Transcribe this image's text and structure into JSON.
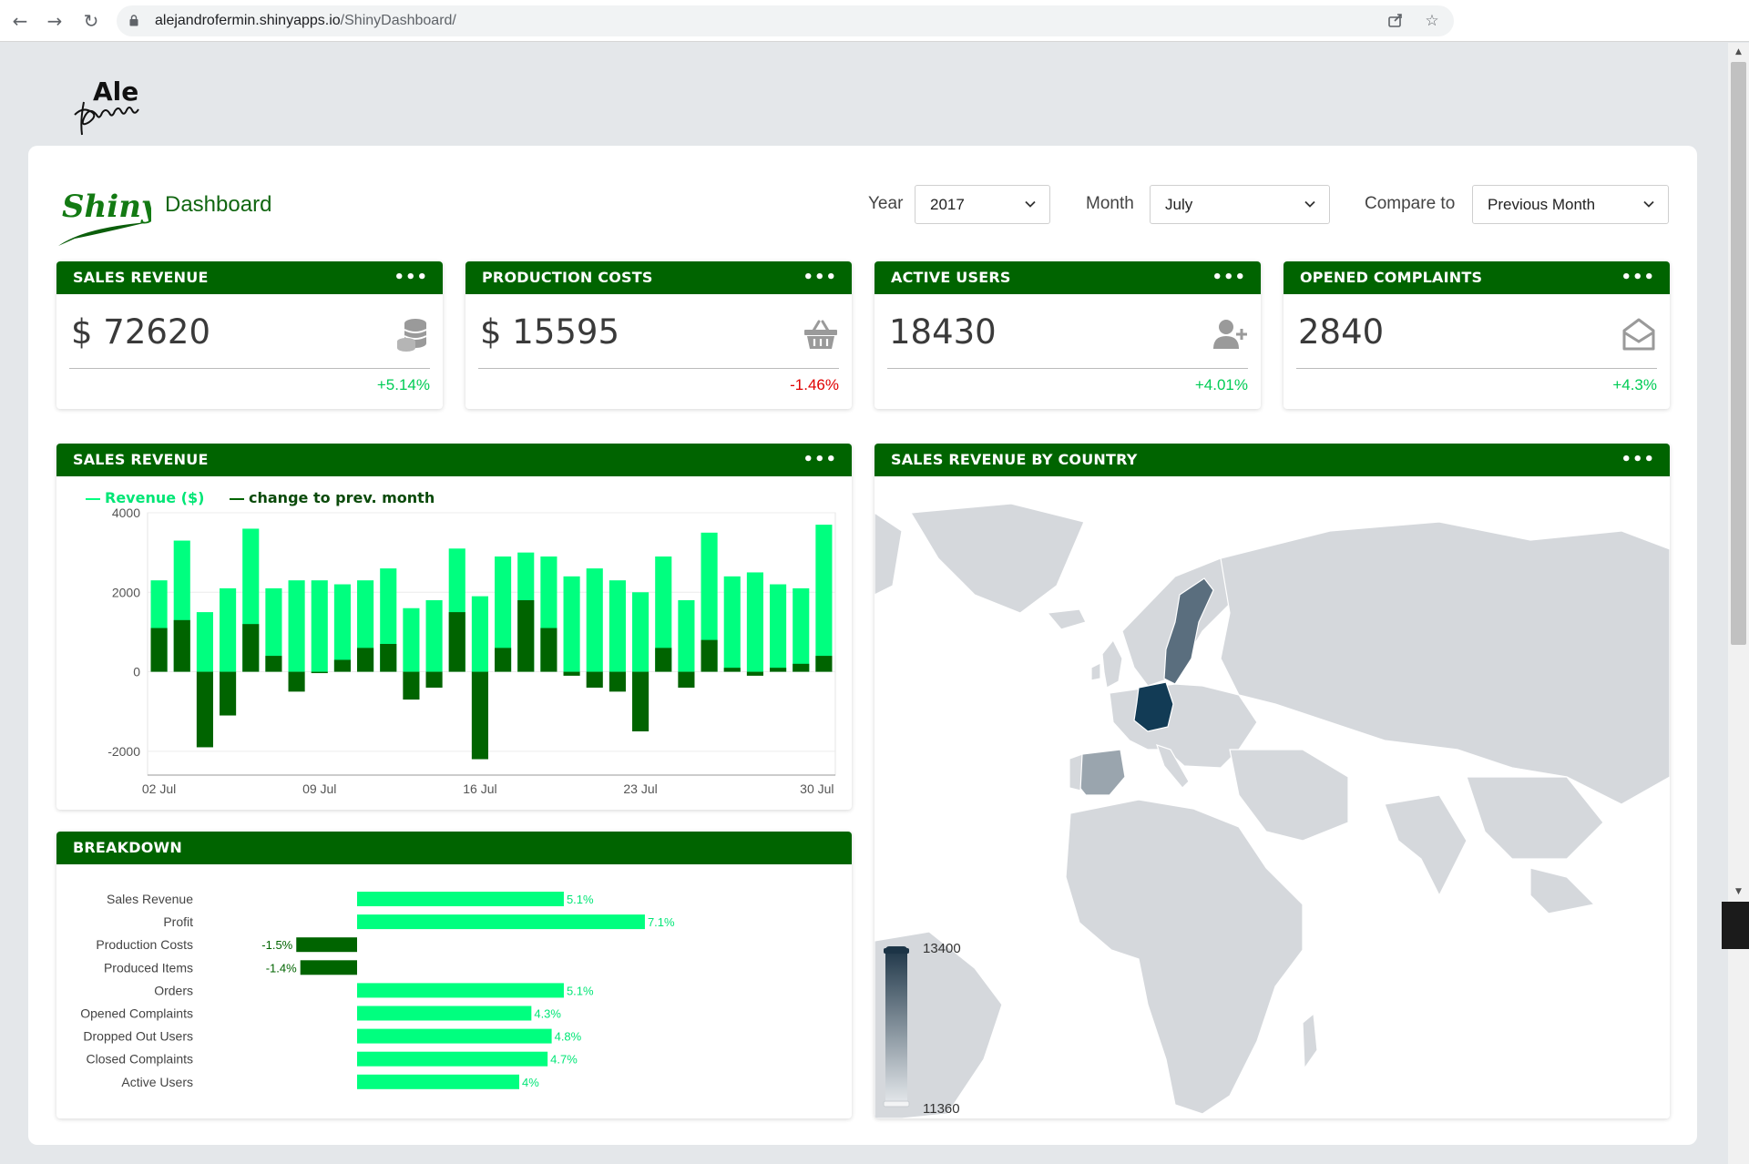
{
  "browser": {
    "url_host": "alejandrofermin.shinyapps.io",
    "url_path": "/ShinyDashboard/"
  },
  "colors": {
    "brand_green": "#006400",
    "bright_green": "#00ff7f",
    "dark_green": "#006400",
    "negative": "#e00000",
    "positive": "#00cc55"
  },
  "header": {
    "title": "Dashboard",
    "filters": [
      {
        "label": "Year",
        "value": "2017"
      },
      {
        "label": "Month",
        "value": "July"
      },
      {
        "label": "Compare to",
        "value": "Previous Month"
      }
    ]
  },
  "kpis": [
    {
      "title": "SALES REVENUE",
      "value": "$ 72620",
      "change": "+5.14%",
      "positive": true,
      "icon": "coins-icon"
    },
    {
      "title": "PRODUCTION COSTS",
      "value": "$ 15595",
      "change": "-1.46%",
      "positive": false,
      "icon": "basket-icon"
    },
    {
      "title": "ACTIVE USERS",
      "value": "18430",
      "change": "+4.01%",
      "positive": true,
      "icon": "user-plus-icon"
    },
    {
      "title": "OPENED COMPLAINTS",
      "value": "2840",
      "change": "+4.3%",
      "positive": true,
      "icon": "envelope-open-icon"
    }
  ],
  "sales_panel": {
    "title": "SALES REVENUE",
    "legend": [
      "Revenue ($)",
      "change to prev. month"
    ]
  },
  "breakdown_panel": {
    "title": "BREAKDOWN"
  },
  "map_panel": {
    "title": "SALES REVENUE BY COUNTRY",
    "scale_max": "13400",
    "scale_min": "11360"
  },
  "chart_data": [
    {
      "type": "bar",
      "series": [
        {
          "name": "Revenue ($)",
          "values": [
            2300,
            3300,
            1500,
            2100,
            3600,
            2100,
            2300,
            2300,
            2200,
            2300,
            2600,
            1600,
            1800,
            3100,
            1900,
            2900,
            3000,
            2900,
            2400,
            2600,
            2300,
            2000,
            2900,
            1800,
            3500,
            2400,
            2500,
            2200,
            2100,
            3700
          ]
        },
        {
          "name": "change to prev. month",
          "values": [
            1100,
            1300,
            -1900,
            -1100,
            1200,
            400,
            -500,
            0,
            300,
            600,
            700,
            -700,
            -400,
            1500,
            -2200,
            600,
            1800,
            1100,
            -100,
            -400,
            -500,
            -1500,
            600,
            -400,
            800,
            100,
            -100,
            100,
            200,
            400
          ]
        }
      ],
      "x_ticks": [
        "02 Jul",
        "09 Jul",
        "16 Jul",
        "23 Jul",
        "30 Jul"
      ],
      "y_ticks": [
        "4000",
        "2000",
        "0",
        "-2000"
      ],
      "ylim": [
        -2600,
        4000
      ]
    },
    {
      "type": "bar",
      "orientation": "horizontal",
      "categories": [
        "Sales Revenue",
        "Profit",
        "Production Costs",
        "Produced Items",
        "Orders",
        "Opened Complaints",
        "Dropped Out Users",
        "Closed Complaints",
        "Active Users"
      ],
      "values": [
        5.1,
        7.1,
        -1.5,
        -1.4,
        5.1,
        4.3,
        4.8,
        4.7,
        4.0
      ],
      "labels": [
        "5.1%",
        "7.1%",
        "-1.5%",
        "-1.4%",
        "5.1%",
        "4.3%",
        "4.8%",
        "4.7%",
        "4%"
      ]
    }
  ]
}
